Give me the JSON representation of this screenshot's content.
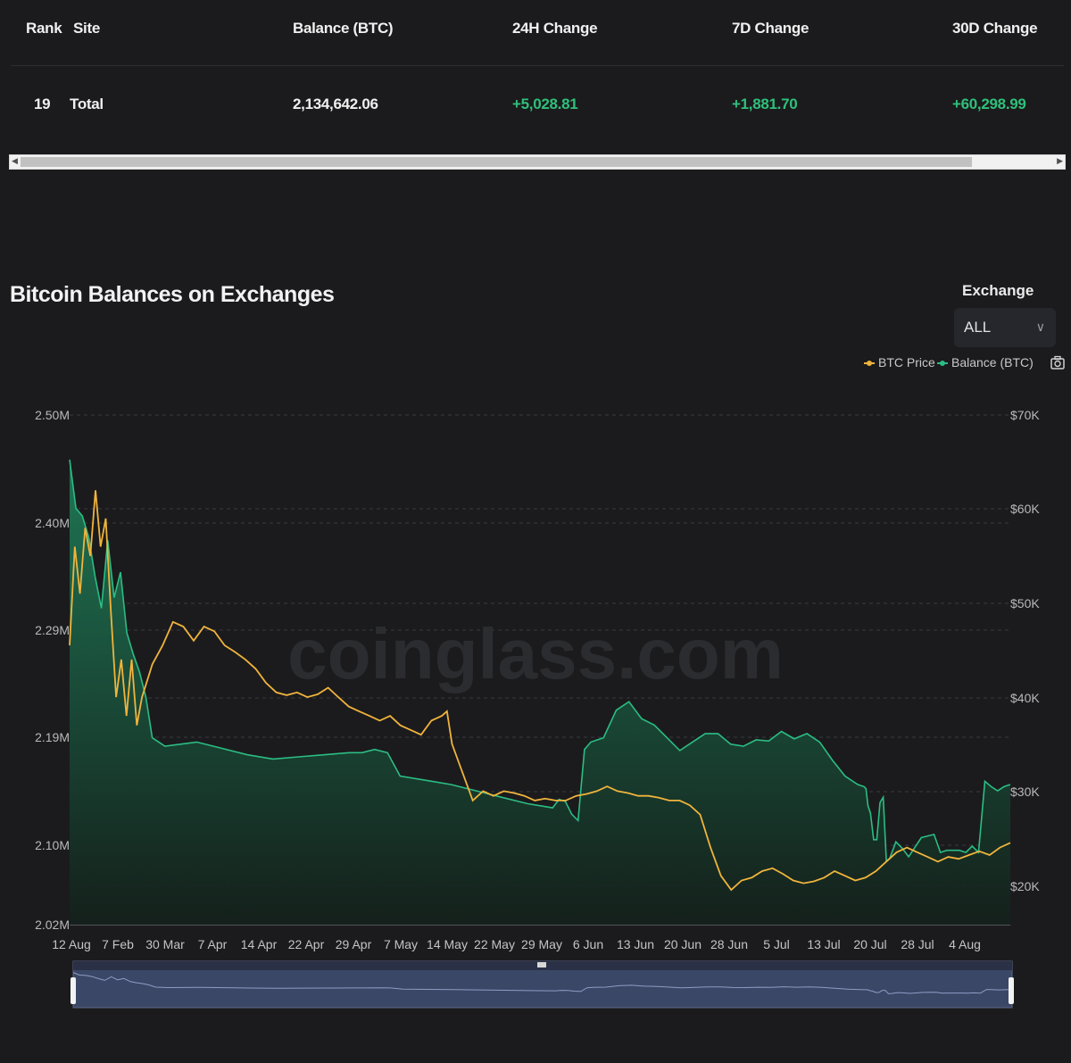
{
  "table": {
    "headers": [
      "Rank",
      "Site",
      "Balance (BTC)",
      "24H Change",
      "7D Change",
      "30D Change"
    ],
    "row": {
      "rank": "19",
      "site": "Total",
      "balance": "2,134,642.06",
      "change_24h": "+5,028.81",
      "change_7d": "+1,881.70",
      "change_30d": "+60,298.99"
    }
  },
  "section_title": "Bitcoin Balances on Exchanges",
  "exchange_filter": {
    "label": "Exchange",
    "selected": "ALL",
    "icon": "chevron-down-icon"
  },
  "legend": {
    "price_label": "BTC Price",
    "balance_label": "Balance (BTC)",
    "camera_icon": "camera-icon"
  },
  "watermark": "coinglass.com",
  "colors": {
    "price": "#f0b43c",
    "balance": "#2bbd84",
    "positive": "#2fc07a",
    "background": "#1b1b1d"
  },
  "chart_data": {
    "type": "line",
    "x_ticks": [
      "12 Aug",
      "7 Feb",
      "30 Mar",
      "7 Apr",
      "14 Apr",
      "22 Apr",
      "29 Apr",
      "7 May",
      "14 May",
      "22 May",
      "29 May",
      "6 Jun",
      "13 Jun",
      "20 Jun",
      "28 Jun",
      "5 Jul",
      "13 Jul",
      "20 Jul",
      "28 Jul",
      "4 Aug"
    ],
    "y_left_ticks": [
      "2.02M",
      "2.10M",
      "2.19M",
      "2.29M",
      "2.40M",
      "2.50M"
    ],
    "y_right_ticks": [
      "$20K",
      "$30K",
      "$40K",
      "$50K",
      "$60K",
      "$70K"
    ],
    "y_left_range": [
      2020000,
      2500000
    ],
    "y_right_range": [
      15800,
      70000
    ],
    "x_range": [
      0,
      148
    ],
    "series": [
      {
        "name": "Balance (BTC)",
        "axis": "left",
        "area": true,
        "points": [
          [
            0,
            2458000
          ],
          [
            1,
            2412000
          ],
          [
            2,
            2405000
          ],
          [
            3,
            2385000
          ],
          [
            4,
            2348000
          ],
          [
            5,
            2318000
          ],
          [
            6,
            2382000
          ],
          [
            7,
            2328000
          ],
          [
            8,
            2352000
          ],
          [
            9,
            2295000
          ],
          [
            10,
            2275000
          ],
          [
            11,
            2258000
          ],
          [
            12,
            2234000
          ],
          [
            13,
            2196000
          ],
          [
            15,
            2188000
          ],
          [
            20,
            2192000
          ],
          [
            24,
            2186000
          ],
          [
            28,
            2180000
          ],
          [
            32,
            2176000
          ],
          [
            36,
            2178000
          ],
          [
            40,
            2180000
          ],
          [
            44,
            2182000
          ],
          [
            46,
            2182000
          ],
          [
            48,
            2185000
          ],
          [
            50,
            2182000
          ],
          [
            52,
            2160000
          ],
          [
            56,
            2156000
          ],
          [
            60,
            2152000
          ],
          [
            64,
            2146000
          ],
          [
            68,
            2140000
          ],
          [
            72,
            2134000
          ],
          [
            76,
            2130000
          ],
          [
            77,
            2138000
          ],
          [
            78,
            2136000
          ],
          [
            79,
            2124000
          ],
          [
            80,
            2118000
          ],
          [
            81,
            2185000
          ],
          [
            82,
            2192000
          ],
          [
            84,
            2196000
          ],
          [
            86,
            2222000
          ],
          [
            88,
            2230000
          ],
          [
            90,
            2214000
          ],
          [
            92,
            2208000
          ],
          [
            94,
            2196000
          ],
          [
            96,
            2184000
          ],
          [
            98,
            2192000
          ],
          [
            100,
            2200000
          ],
          [
            102,
            2200000
          ],
          [
            104,
            2190000
          ],
          [
            106,
            2188000
          ],
          [
            108,
            2194000
          ],
          [
            110,
            2193000
          ],
          [
            112,
            2202000
          ],
          [
            114,
            2195000
          ],
          [
            116,
            2200000
          ],
          [
            118,
            2192000
          ],
          [
            120,
            2175000
          ],
          [
            122,
            2160000
          ],
          [
            124,
            2152000
          ],
          [
            125,
            2150000
          ],
          [
            125.3,
            2148000
          ],
          [
            125.6,
            2132000
          ],
          [
            126,
            2125000
          ],
          [
            126.5,
            2100000
          ],
          [
            127,
            2100000
          ],
          [
            127.5,
            2135000
          ],
          [
            128,
            2140000
          ],
          [
            128.5,
            2080000
          ],
          [
            129,
            2082000
          ],
          [
            130,
            2098000
          ],
          [
            131,
            2092000
          ],
          [
            132,
            2084000
          ],
          [
            134,
            2102000
          ],
          [
            136,
            2105000
          ],
          [
            137,
            2088000
          ],
          [
            138,
            2090000
          ],
          [
            140,
            2090000
          ],
          [
            141,
            2088000
          ],
          [
            142,
            2094000
          ],
          [
            143,
            2088000
          ],
          [
            143.5,
            2122000
          ],
          [
            144,
            2155000
          ],
          [
            145,
            2150000
          ],
          [
            146,
            2146000
          ],
          [
            147,
            2150000
          ],
          [
            148,
            2152000
          ]
        ]
      },
      {
        "name": "BTC Price",
        "axis": "right",
        "area": false,
        "points": [
          [
            0,
            45500
          ],
          [
            1,
            56000
          ],
          [
            2,
            51000
          ],
          [
            3,
            58000
          ],
          [
            4,
            55000
          ],
          [
            5,
            62000
          ],
          [
            6,
            56000
          ],
          [
            7,
            59000
          ],
          [
            8,
            49000
          ],
          [
            9,
            40000
          ],
          [
            10,
            44000
          ],
          [
            11,
            38000
          ],
          [
            12,
            44000
          ],
          [
            13,
            37000
          ],
          [
            14,
            40000
          ],
          [
            16,
            43500
          ],
          [
            18,
            45500
          ],
          [
            20,
            48000
          ],
          [
            22,
            47500
          ],
          [
            24,
            46000
          ],
          [
            26,
            47500
          ],
          [
            28,
            47000
          ],
          [
            30,
            45500
          ],
          [
            32,
            44800
          ],
          [
            34,
            44000
          ],
          [
            36,
            43000
          ],
          [
            38,
            41500
          ],
          [
            40,
            40500
          ],
          [
            42,
            40200
          ],
          [
            44,
            40500
          ],
          [
            46,
            40000
          ],
          [
            48,
            40300
          ],
          [
            50,
            41000
          ],
          [
            52,
            40000
          ],
          [
            54,
            39000
          ],
          [
            56,
            38500
          ],
          [
            58,
            38000
          ],
          [
            60,
            37500
          ],
          [
            62,
            38000
          ],
          [
            64,
            37000
          ],
          [
            66,
            36500
          ],
          [
            68,
            36000
          ],
          [
            70,
            37500
          ],
          [
            72,
            38000
          ],
          [
            73,
            38500
          ],
          [
            74,
            35000
          ],
          [
            75,
            33500
          ],
          [
            76,
            32000
          ],
          [
            77,
            30500
          ],
          [
            78,
            29000
          ],
          [
            80,
            30000
          ],
          [
            82,
            29500
          ],
          [
            84,
            30000
          ],
          [
            86,
            29800
          ],
          [
            88,
            29500
          ],
          [
            90,
            29000
          ],
          [
            92,
            29200
          ],
          [
            94,
            29000
          ],
          [
            96,
            29000
          ],
          [
            98,
            29500
          ],
          [
            100,
            29700
          ],
          [
            102,
            30000
          ],
          [
            104,
            30500
          ],
          [
            106,
            30000
          ],
          [
            108,
            29800
          ],
          [
            110,
            29500
          ],
          [
            112,
            29500
          ],
          [
            114,
            29300
          ],
          [
            116,
            29000
          ],
          [
            118,
            29000
          ],
          [
            120,
            28500
          ],
          [
            122,
            27500
          ],
          [
            124,
            24000
          ],
          [
            126,
            21000
          ],
          [
            128,
            19500
          ],
          [
            130,
            20500
          ],
          [
            132,
            20800
          ],
          [
            134,
            21500
          ],
          [
            136,
            21800
          ],
          [
            138,
            21200
          ],
          [
            140,
            20500
          ],
          [
            142,
            20200
          ],
          [
            144,
            20400
          ],
          [
            146,
            20800
          ],
          [
            148,
            21500
          ],
          [
            150,
            21000
          ],
          [
            152,
            20500
          ],
          [
            154,
            20800
          ],
          [
            156,
            21500
          ],
          [
            158,
            22500
          ],
          [
            160,
            23500
          ],
          [
            162,
            24000
          ],
          [
            164,
            23500
          ],
          [
            166,
            23000
          ],
          [
            168,
            22500
          ],
          [
            170,
            23000
          ],
          [
            172,
            22800
          ],
          [
            174,
            23200
          ],
          [
            176,
            23600
          ],
          [
            178,
            23200
          ],
          [
            180,
            24000
          ],
          [
            182,
            24500
          ]
        ]
      }
    ]
  }
}
